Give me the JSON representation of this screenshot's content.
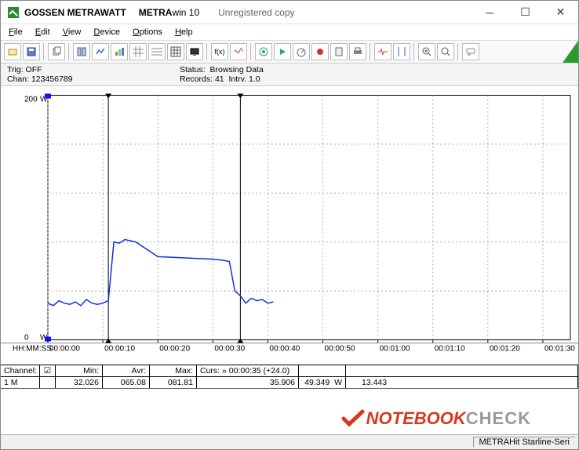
{
  "title": {
    "brand": "GOSSEN METRAWATT",
    "app_a": "METRA",
    "app_b": "win 10",
    "copy": "Unregistered copy"
  },
  "menu": {
    "file": "File",
    "edit": "Edit",
    "view": "View",
    "device": "Device",
    "options": "Options",
    "help": "Help"
  },
  "status": {
    "trig_l": "Trig:",
    "trig_v": "OFF",
    "chan_l": "Chan:",
    "chan_v": "123456789",
    "stat_l": "Status:",
    "stat_v": "Browsing Data",
    "rec_l": "Records:",
    "rec_v": "41",
    "intrv_l": "Intrv.",
    "intrv_v": "1.0"
  },
  "chart_data": {
    "type": "line",
    "title": "",
    "xlabel": "HH:MM:SS",
    "ylabel": "W",
    "ylim": [
      0,
      200
    ],
    "yunit": "W",
    "xticks": [
      "00:00:00",
      "00:00:10",
      "00:00:20",
      "00:00:30",
      "00:00:40",
      "00:00:50",
      "00:01:00",
      "00:01:10",
      "00:01:20",
      "00:01:30"
    ],
    "cursor1_sec": 11,
    "cursor2_sec": 35,
    "series": [
      {
        "name": "1 M",
        "x_sec": [
          0,
          1,
          2,
          3,
          4,
          5,
          6,
          7,
          8,
          9,
          10,
          11,
          12,
          13,
          14,
          15,
          16,
          20,
          25,
          30,
          32,
          33,
          34,
          35,
          36,
          37,
          38,
          39,
          40,
          41
        ],
        "y": [
          30,
          28,
          32,
          30,
          29,
          31,
          28,
          33,
          30,
          29,
          30,
          32,
          80,
          79,
          82,
          81,
          80,
          68,
          67,
          66,
          65,
          64,
          40,
          36,
          30,
          34,
          32,
          33,
          30,
          31
        ]
      }
    ]
  },
  "table": {
    "h_channel": "Channel:",
    "h_min": "Min:",
    "h_avr": "Avr:",
    "h_max": "Max:",
    "h_curs": "Curs: » 00:00:35 (+24.0)",
    "rows": [
      {
        "ch": "1  M",
        "min": "32.026",
        "avr": "065.08",
        "max": "081.81",
        "c1": "35.906",
        "c2": "49.349",
        "unit": "W",
        "diff": "13.443"
      }
    ]
  },
  "bottom": {
    "device": "METRAHit Starline-Seri"
  },
  "watermark": {
    "a": "NOTEBOOK",
    "b": "CHECK"
  }
}
